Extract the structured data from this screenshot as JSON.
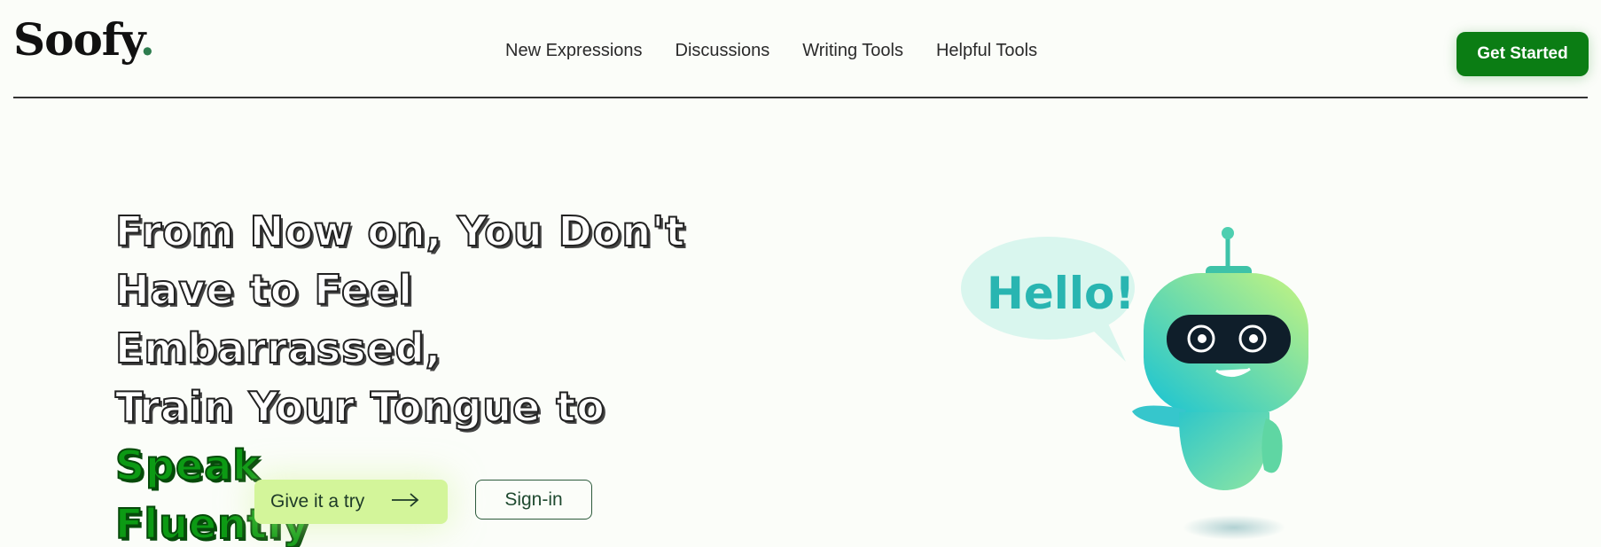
{
  "brand": {
    "name": "Soofy",
    "dot": "."
  },
  "nav": {
    "items": [
      {
        "label": "New Expressions"
      },
      {
        "label": "Discussions"
      },
      {
        "label": "Writing Tools"
      },
      {
        "label": "Helpful Tools"
      }
    ]
  },
  "header": {
    "cta_label": "Get Started"
  },
  "hero": {
    "headline_lines": [
      "From Now on, You Don't",
      "Have to Feel Embarrassed,",
      "Train Your Tongue to "
    ],
    "headline_highlight_1": "Speak",
    "headline_highlight_2": "Fluently",
    "try_label": "Give it a try",
    "signin_label": "Sign-in",
    "bubble_text": "Hello!"
  },
  "colors": {
    "accent": "#0b7d14",
    "try_button": "#d3f59a",
    "background": "#fbfdf9"
  },
  "icons": {
    "try_arrow": "arrow-right-icon"
  }
}
